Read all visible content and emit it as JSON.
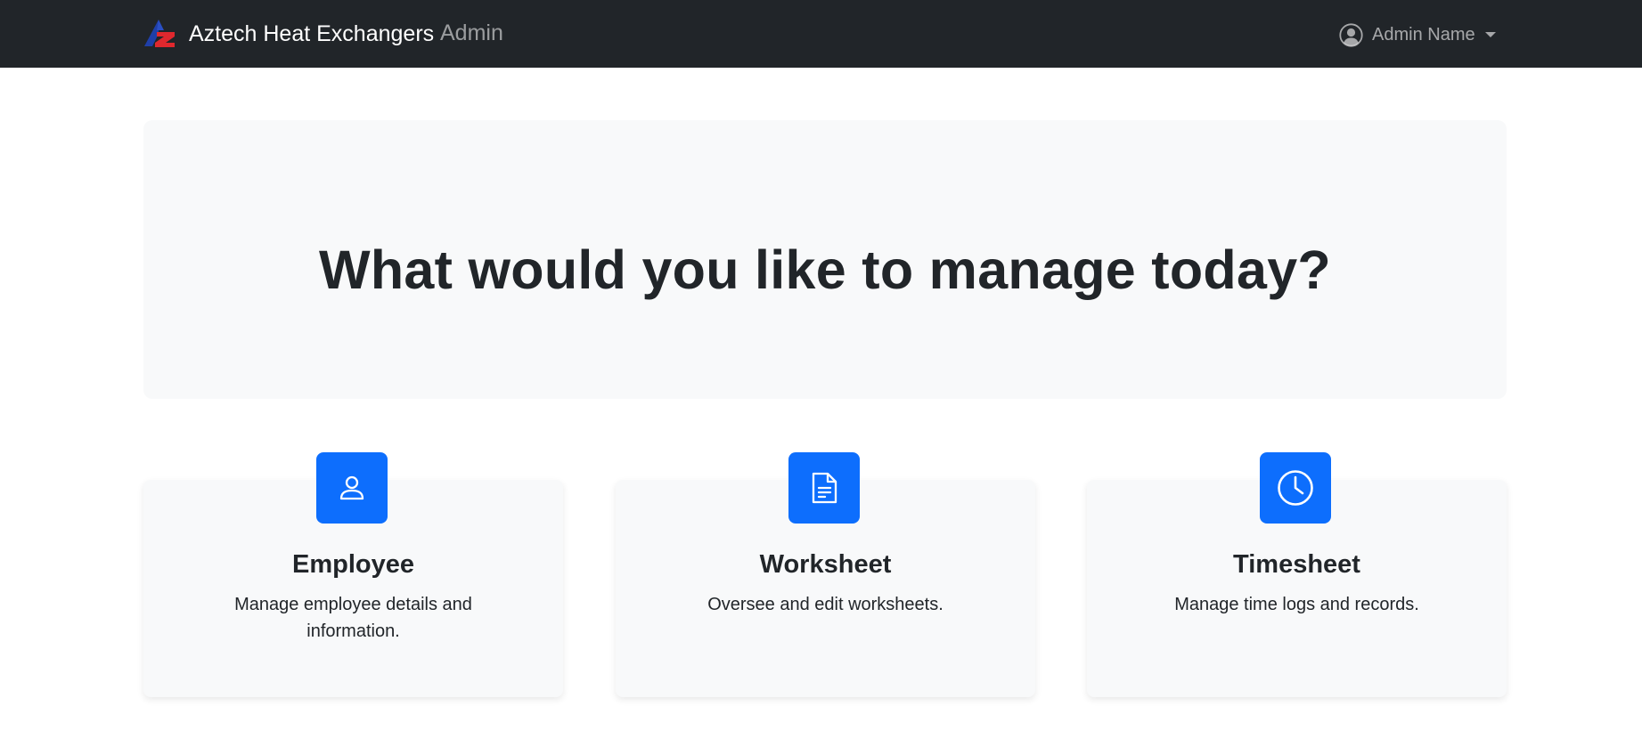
{
  "navbar": {
    "brand_name": "Aztech Heat Exchangers",
    "admin_link": "Admin",
    "user_name": "Admin Name",
    "background": "#212529"
  },
  "hero": {
    "title": "What would you like to manage today?"
  },
  "cards": [
    {
      "icon": "person-icon",
      "title": "Employee",
      "description": "Manage employee details and information."
    },
    {
      "icon": "document-icon",
      "title": "Worksheet",
      "description": "Oversee and edit worksheets."
    },
    {
      "icon": "clock-icon",
      "title": "Timesheet",
      "description": "Manage time logs and records."
    }
  ],
  "colors": {
    "accent": "#0d6efd",
    "card_background": "#f8f9fa",
    "logo_blue": "#1f3fa8",
    "logo_red": "#e0282e"
  }
}
